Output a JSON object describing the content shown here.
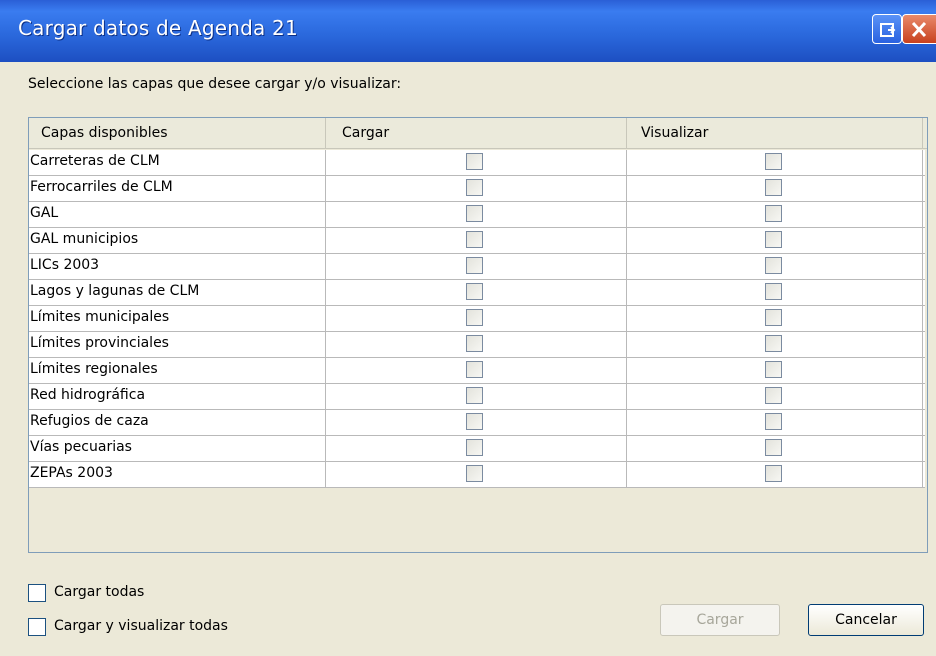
{
  "window": {
    "title": "Cargar datos de Agenda 21"
  },
  "instruction": "Seleccione las capas que desee cargar y/o visualizar:",
  "table": {
    "headers": [
      "Capas disponibles",
      "Cargar",
      "Visualizar"
    ],
    "rows": [
      {
        "name": "Carreteras de CLM",
        "cargar": false,
        "visualizar": false
      },
      {
        "name": "Ferrocarriles de CLM",
        "cargar": false,
        "visualizar": false
      },
      {
        "name": "GAL",
        "cargar": false,
        "visualizar": false
      },
      {
        "name": "GAL municipios",
        "cargar": false,
        "visualizar": false
      },
      {
        "name": "LICs 2003",
        "cargar": false,
        "visualizar": false
      },
      {
        "name": "Lagos y lagunas de CLM",
        "cargar": false,
        "visualizar": false
      },
      {
        "name": "Límites municipales",
        "cargar": false,
        "visualizar": false
      },
      {
        "name": "Límites provinciales",
        "cargar": false,
        "visualizar": false
      },
      {
        "name": "Límites regionales",
        "cargar": false,
        "visualizar": false
      },
      {
        "name": "Red hidrográfica",
        "cargar": false,
        "visualizar": false
      },
      {
        "name": "Refugios de caza",
        "cargar": false,
        "visualizar": false
      },
      {
        "name": "Vías pecuarias",
        "cargar": false,
        "visualizar": false
      },
      {
        "name": "ZEPAs 2003",
        "cargar": false,
        "visualizar": false
      }
    ]
  },
  "options": {
    "cargar_todas": "Cargar todas",
    "cargar_visualizar_todas": "Cargar y visualizar todas"
  },
  "buttons": {
    "cargar": "Cargar",
    "cancelar": "Cancelar"
  },
  "colors": {
    "titlebar": "#2b69dd",
    "close": "#c8411e",
    "dialog_bg": "#ece9d8"
  },
  "icons": {
    "restore": "restore-window-icon",
    "close": "close-icon"
  }
}
